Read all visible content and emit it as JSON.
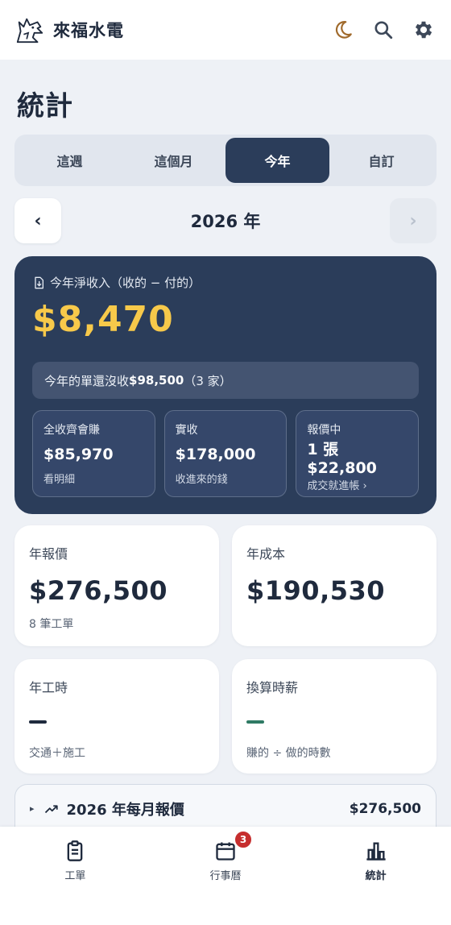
{
  "app": {
    "title": "來福水電"
  },
  "icons": {
    "logo": "wolf-logo-icon",
    "theme": "moon-icon",
    "search": "search-icon",
    "settings": "gear-icon"
  },
  "page": {
    "title": "統計"
  },
  "tabs": [
    {
      "label": "這週",
      "active": false
    },
    {
      "label": "這個月",
      "active": false
    },
    {
      "label": "今年",
      "active": true
    },
    {
      "label": "自訂",
      "active": false
    }
  ],
  "year_nav": {
    "prev": "‹",
    "label": "2026 年",
    "next": "›"
  },
  "hero": {
    "label": "今年淨收入（收的 − 付的）",
    "amount": "$8,470",
    "notice": {
      "prefix": "今年的單還沒收 ",
      "amount": "$98,500",
      "suffix": "（3 家）"
    },
    "cards": [
      {
        "title": "全收齊會賺",
        "value": "$85,970",
        "sub": "看明細"
      },
      {
        "title": "實收",
        "value": "$178,000",
        "sub": "收進來的錢"
      },
      {
        "title": "報價中",
        "value": "1 張 $22,800",
        "sub": "成交就進帳 ›"
      }
    ]
  },
  "stats": {
    "quote": {
      "title": "年報價",
      "value": "$276,500",
      "sub": "8 筆工單"
    },
    "cost": {
      "title": "年成本",
      "value": "$190,530"
    },
    "hours": {
      "title": "年工時",
      "sub": "交通＋施工"
    },
    "hourly": {
      "title": "換算時薪",
      "sub": "賺的 ÷ 做的時數"
    }
  },
  "monthly": {
    "caret": "▸",
    "title": "2026 年每月報價",
    "total": "$276,500"
  },
  "bottom_nav": [
    {
      "label": "工單",
      "icon": "clipboard-icon",
      "active": false
    },
    {
      "label": "行事曆",
      "icon": "calendar-icon",
      "active": false,
      "badge": "3"
    },
    {
      "label": "統計",
      "icon": "bar-chart-icon",
      "active": true
    }
  ],
  "colors": {
    "navy": "#2b3d5a",
    "accent_yellow": "#f7c94a",
    "moon": "#a06a2c",
    "badge_red": "#c62e2e",
    "hourly_green": "#2f7a64"
  }
}
